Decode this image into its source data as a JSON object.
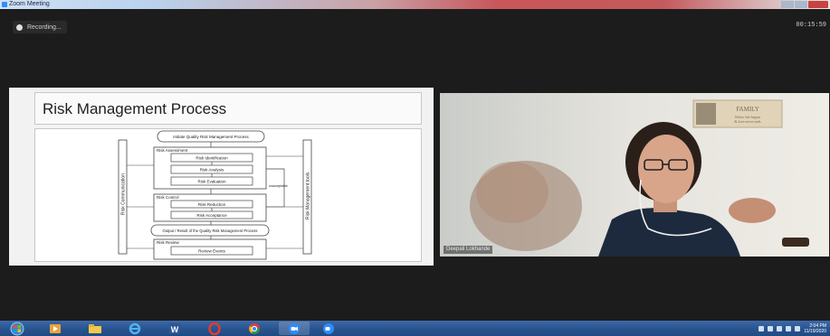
{
  "window": {
    "title": "Zoom Meeting"
  },
  "recording": {
    "label": "Recording..."
  },
  "meeting_timer": "00:15:59",
  "slide": {
    "title": "Risk Management Process",
    "start_box": "Initiate Quality Risk Management Process",
    "assessment": "Risk Assessment",
    "identification": "Risk Identification",
    "analysis": "Risk Analysis",
    "evaluation": "Risk Evaluation",
    "control": "Risk Control",
    "reduction": "Risk Reduction",
    "acceptance": "Risk Acceptance",
    "output_box": "Output / Result of the Quality Risk Management Process",
    "review": "Risk Review",
    "review_events": "Review Events",
    "communication": "Risk Communication",
    "tools": "Risk Management tools",
    "unacceptable": "unacceptable"
  },
  "video": {
    "participant_name": "Deepali Lokhande",
    "poster_title": "FAMILY",
    "poster_line1": "Where life begins",
    "poster_line2": "& love never ends"
  },
  "taskbar": {
    "clock_time": "2:04 PM",
    "clock_date": "11/19/2020"
  },
  "colors": {
    "zoom_blue": "#2d8cff",
    "taskbar": "#2a5590",
    "meeting_bg": "#1c1c1c"
  }
}
